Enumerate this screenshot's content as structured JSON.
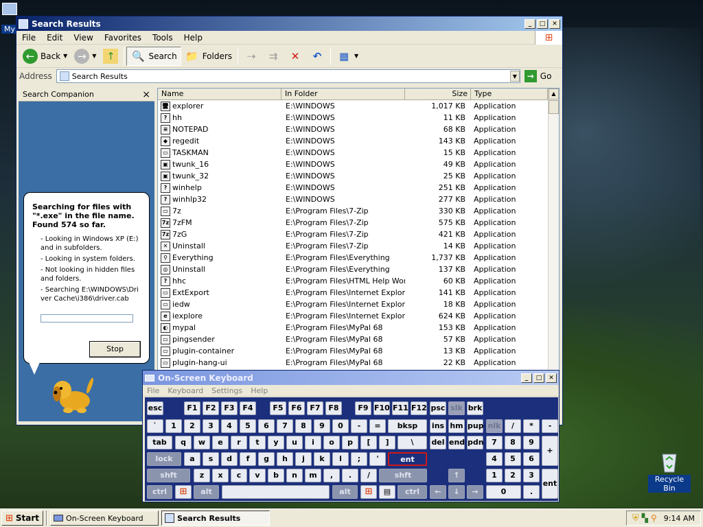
{
  "desktop": {
    "my_icon_label": "My",
    "recycle_label": "Recycle Bin"
  },
  "explorer": {
    "title": "Search Results",
    "menu": [
      "File",
      "Edit",
      "View",
      "Favorites",
      "Tools",
      "Help"
    ],
    "toolbar": {
      "back": "Back",
      "search": "Search",
      "folders": "Folders"
    },
    "address_label": "Address",
    "address_value": "Search Results",
    "go_label": "Go",
    "companion": {
      "title": "Search Companion",
      "close": "×",
      "heading": "Searching for files with \"*.exe\" in the file name. Found 574 so far.",
      "items": [
        "- Looking in Windows XP (E:) and in subfolders.",
        "- Looking in system folders.",
        "- Not looking in hidden files and folders.",
        "- Searching E:\\WINDOWS\\Driver Cache\\i386\\driver.cab"
      ],
      "stop_label": "Stop"
    },
    "columns": [
      "Name",
      "In Folder",
      "Size",
      "Type"
    ],
    "files": [
      {
        "icon": "explorer-icon",
        "glyph": "🖥",
        "name": "explorer",
        "folder": "E:\\WINDOWS",
        "size": "1,017 KB",
        "type": "Application"
      },
      {
        "icon": "help-icon",
        "glyph": "?",
        "name": "hh",
        "folder": "E:\\WINDOWS",
        "size": "11 KB",
        "type": "Application"
      },
      {
        "icon": "notepad-icon",
        "glyph": "≡",
        "name": "NOTEPAD",
        "folder": "E:\\WINDOWS",
        "size": "68 KB",
        "type": "Application"
      },
      {
        "icon": "regedit-icon",
        "glyph": "◆",
        "name": "regedit",
        "folder": "E:\\WINDOWS",
        "size": "143 KB",
        "type": "Application"
      },
      {
        "icon": "app-icon",
        "glyph": "▭",
        "name": "TASKMAN",
        "folder": "E:\\WINDOWS",
        "size": "15 KB",
        "type": "Application"
      },
      {
        "icon": "twain-icon",
        "glyph": "▣",
        "name": "twunk_16",
        "folder": "E:\\WINDOWS",
        "size": "49 KB",
        "type": "Application"
      },
      {
        "icon": "twain-icon",
        "glyph": "▣",
        "name": "twunk_32",
        "folder": "E:\\WINDOWS",
        "size": "25 KB",
        "type": "Application"
      },
      {
        "icon": "winhelp-icon",
        "glyph": "?",
        "name": "winhelp",
        "folder": "E:\\WINDOWS",
        "size": "251 KB",
        "type": "Application"
      },
      {
        "icon": "winhelp-icon",
        "glyph": "?",
        "name": "winhlp32",
        "folder": "E:\\WINDOWS",
        "size": "277 KB",
        "type": "Application"
      },
      {
        "icon": "app-icon",
        "glyph": "▭",
        "name": "7z",
        "folder": "E:\\Program Files\\7-Zip",
        "size": "330 KB",
        "type": "Application"
      },
      {
        "icon": "7zip-icon",
        "glyph": "7z",
        "name": "7zFM",
        "folder": "E:\\Program Files\\7-Zip",
        "size": "575 KB",
        "type": "Application"
      },
      {
        "icon": "7zip-icon",
        "glyph": "7z",
        "name": "7zG",
        "folder": "E:\\Program Files\\7-Zip",
        "size": "421 KB",
        "type": "Application"
      },
      {
        "icon": "uninstall-icon",
        "glyph": "✕",
        "name": "Uninstall",
        "folder": "E:\\Program Files\\7-Zip",
        "size": "14 KB",
        "type": "Application"
      },
      {
        "icon": "everything-icon",
        "glyph": "⚲",
        "name": "Everything",
        "folder": "E:\\Program Files\\Everything",
        "size": "1,737 KB",
        "type": "Application"
      },
      {
        "icon": "uninstall-icon",
        "glyph": "◎",
        "name": "Uninstall",
        "folder": "E:\\Program Files\\Everything",
        "size": "137 KB",
        "type": "Application"
      },
      {
        "icon": "help-icon",
        "glyph": "?",
        "name": "hhc",
        "folder": "E:\\Program Files\\HTML Help Wor…",
        "size": "60 KB",
        "type": "Application"
      },
      {
        "icon": "app-icon",
        "glyph": "▭",
        "name": "ExtExport",
        "folder": "E:\\Program Files\\Internet Explorer",
        "size": "141 KB",
        "type": "Application"
      },
      {
        "icon": "app-icon",
        "glyph": "▭",
        "name": "iedw",
        "folder": "E:\\Program Files\\Internet Explorer",
        "size": "18 KB",
        "type": "Application"
      },
      {
        "icon": "ie-icon",
        "glyph": "e",
        "name": "iexplore",
        "folder": "E:\\Program Files\\Internet Explorer",
        "size": "624 KB",
        "type": "Application"
      },
      {
        "icon": "mypal-icon",
        "glyph": "◐",
        "name": "mypal",
        "folder": "E:\\Program Files\\MyPal 68",
        "size": "153 KB",
        "type": "Application"
      },
      {
        "icon": "app-icon",
        "glyph": "▭",
        "name": "pingsender",
        "folder": "E:\\Program Files\\MyPal 68",
        "size": "57 KB",
        "type": "Application"
      },
      {
        "icon": "app-icon",
        "glyph": "▭",
        "name": "plugin-container",
        "folder": "E:\\Program Files\\MyPal 68",
        "size": "13 KB",
        "type": "Application"
      },
      {
        "icon": "app-icon",
        "glyph": "▭",
        "name": "plugin-hang-ui",
        "folder": "E:\\Program Files\\MyPal 68",
        "size": "22 KB",
        "type": "Application"
      }
    ]
  },
  "osk": {
    "title": "On-Screen Keyboard",
    "menu": [
      "File",
      "Keyboard",
      "Settings",
      "Help"
    ],
    "keys": {
      "esc": "esc",
      "f1": "F1",
      "f2": "F2",
      "f3": "F3",
      "f4": "F4",
      "f5": "F5",
      "f6": "F6",
      "f7": "F7",
      "f8": "F8",
      "f9": "F9",
      "f10": "F10",
      "f11": "F11",
      "f12": "F12",
      "psc": "psc",
      "slk": "slk",
      "brk": "brk",
      "backtick": "`",
      "n1": "1",
      "n2": "2",
      "n3": "3",
      "n4": "4",
      "n5": "5",
      "n6": "6",
      "n7": "7",
      "n8": "8",
      "n9": "9",
      "n0": "0",
      "minus": "-",
      "equals": "=",
      "bksp": "bksp",
      "ins": "ins",
      "hm": "hm",
      "pup": "pup",
      "nlk": "nlk",
      "kslash": "/",
      "kstar": "*",
      "kminus": "-",
      "tab": "tab",
      "q": "q",
      "w": "w",
      "e": "e",
      "r": "r",
      "t": "t",
      "y": "y",
      "u": "u",
      "i": "i",
      "o": "o",
      "p": "p",
      "lbr": "[",
      "rbr": "]",
      "bslash": "\\",
      "del": "del",
      "end": "end",
      "pdn": "pdn",
      "k7": "7",
      "k8": "8",
      "k9": "9",
      "kplus": "+",
      "lock": "lock",
      "a": "a",
      "s": "s",
      "d": "d",
      "f": "f",
      "g": "g",
      "h": "h",
      "j": "j",
      "k": "k",
      "l": "l",
      "semi": ";",
      "quote": "'",
      "ent": "ent",
      "k4": "4",
      "k5": "5",
      "k6": "6",
      "shft": "shft",
      "z": "z",
      "x": "x",
      "c": "c",
      "v": "v",
      "b": "b",
      "n": "n",
      "m": "m",
      "comma": ",",
      "period": ".",
      "slash": "/",
      "shft2": "shft",
      "up": "↑",
      "k1": "1",
      "k2": "2",
      "k3": "3",
      "kent": "ent",
      "ctrl": "ctrl",
      "alt": "alt",
      "alt2": "alt",
      "ctrl2": "ctrl",
      "left": "←",
      "down": "↓",
      "right": "→",
      "k0": "0",
      "kdot": "."
    }
  },
  "taskbar": {
    "start": "Start",
    "items": [
      {
        "label": "On-Screen Keyboard",
        "active": false
      },
      {
        "label": "Search Results",
        "active": true
      }
    ],
    "clock": "9:14 AM"
  }
}
